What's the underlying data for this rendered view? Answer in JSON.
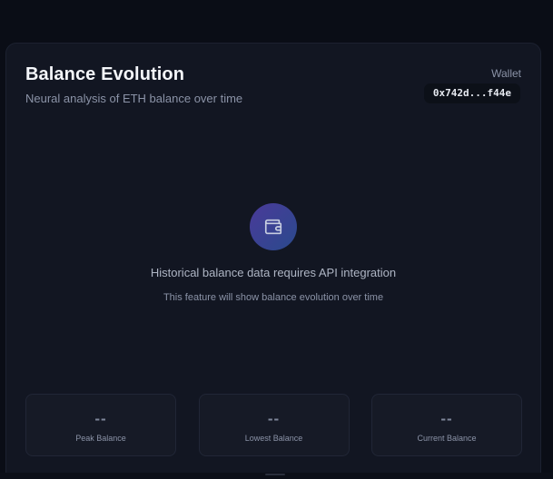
{
  "card": {
    "title": "Balance Evolution",
    "subtitle": "Neural analysis of ETH balance over time"
  },
  "wallet": {
    "label": "Wallet",
    "address": "0x742d...f44e"
  },
  "empty_state": {
    "icon": "wallet-icon",
    "title": "Historical balance data requires API integration",
    "description": "This feature will show balance evolution over time"
  },
  "stats": [
    {
      "value": "--",
      "label": "Peak Balance"
    },
    {
      "value": "--",
      "label": "Lowest Balance"
    },
    {
      "value": "--",
      "label": "Current Balance"
    }
  ],
  "colors": {
    "background": "#0a0d16",
    "card": "#121622",
    "icon_gradient_start": "#4a3a9a",
    "icon_gradient_end": "#2a4a8c"
  }
}
